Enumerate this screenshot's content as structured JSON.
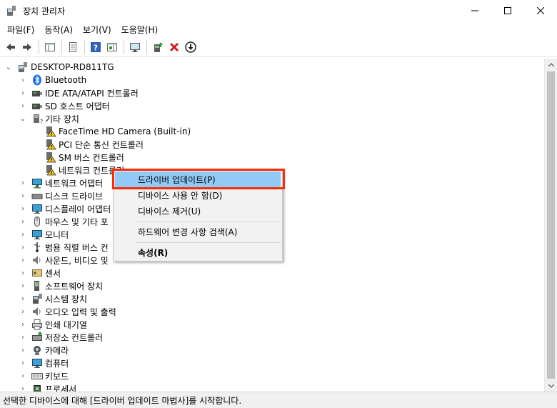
{
  "window": {
    "title": "장치 관리자",
    "min_icon": "minimize-icon",
    "max_icon": "maximize-icon",
    "close_icon": "close-icon"
  },
  "menu": [
    "파일(F)",
    "동작(A)",
    "보기(V)",
    "도움말(H)"
  ],
  "toolbar": [
    "back-icon",
    "forward-icon",
    "show-hide-console-tree-icon",
    "properties-icon",
    "help-icon",
    "action-pane-icon",
    "monitor-icon",
    "update-driver-icon",
    "uninstall-icon",
    "download-icon"
  ],
  "tree": {
    "root": "DESKTOP-RD811TG",
    "nodes": [
      {
        "label": "Bluetooth",
        "icon": "bluetooth-icon"
      },
      {
        "label": "IDE ATA/ATAPI 컨트롤러",
        "icon": "ide-controller-icon"
      },
      {
        "label": "SD 호스트 어댑터",
        "icon": "sd-host-icon"
      },
      {
        "label": "기타 장치",
        "icon": "other-devices-icon"
      },
      {
        "label": "FaceTime HD Camera (Built-in)",
        "icon": "warning-device-icon"
      },
      {
        "label": "PCI 단순 통신 컨트롤러",
        "icon": "warning-device-icon"
      },
      {
        "label": "SM 버스 컨트롤러",
        "icon": "warning-device-icon"
      },
      {
        "label": "네트워크 컨트롤러",
        "icon": "warning-device-icon"
      },
      {
        "label": "네트워크 어댑터",
        "icon": "network-adapter-icon"
      },
      {
        "label": "디스크 드라이브",
        "icon": "disk-drive-icon"
      },
      {
        "label": "디스플레이 어댑터",
        "icon": "display-adapter-icon"
      },
      {
        "label": "마우스 및 기타 포",
        "icon": "mouse-icon"
      },
      {
        "label": "모니터",
        "icon": "monitor-icon"
      },
      {
        "label": "범용 직렬 버스 컨",
        "icon": "usb-icon"
      },
      {
        "label": "사운드, 비디오 및",
        "icon": "sound-icon"
      },
      {
        "label": "센서",
        "icon": "sensor-icon"
      },
      {
        "label": "소프트웨어 장치",
        "icon": "software-device-icon"
      },
      {
        "label": "시스템 장치",
        "icon": "system-device-icon"
      },
      {
        "label": "오디오 입력 및 출력",
        "icon": "audio-icon"
      },
      {
        "label": "인쇄 대기열",
        "icon": "print-queue-icon"
      },
      {
        "label": "저장소 컨트롤러",
        "icon": "storage-controller-icon"
      },
      {
        "label": "카메라",
        "icon": "camera-icon"
      },
      {
        "label": "컴퓨터",
        "icon": "computer-icon"
      },
      {
        "label": "키보드",
        "icon": "keyboard-icon"
      },
      {
        "label": "프로세서",
        "icon": "processor-icon"
      }
    ]
  },
  "context_menu": {
    "update_driver": "드라이버 업데이트(P)",
    "disable": "디바이스 사용 안 함(D)",
    "uninstall": "디바이스 제거(U)",
    "scan": "하드웨어 변경 사항 검색(A)",
    "properties": "속성(R)"
  },
  "status": "선택한 디바이스에 대해 [드라이버 업데이트 마법사]를 시작합니다.",
  "colors": {
    "highlight": "#91c9f7",
    "annotation_box": "#ff2a00",
    "warning": "#f5c518"
  }
}
